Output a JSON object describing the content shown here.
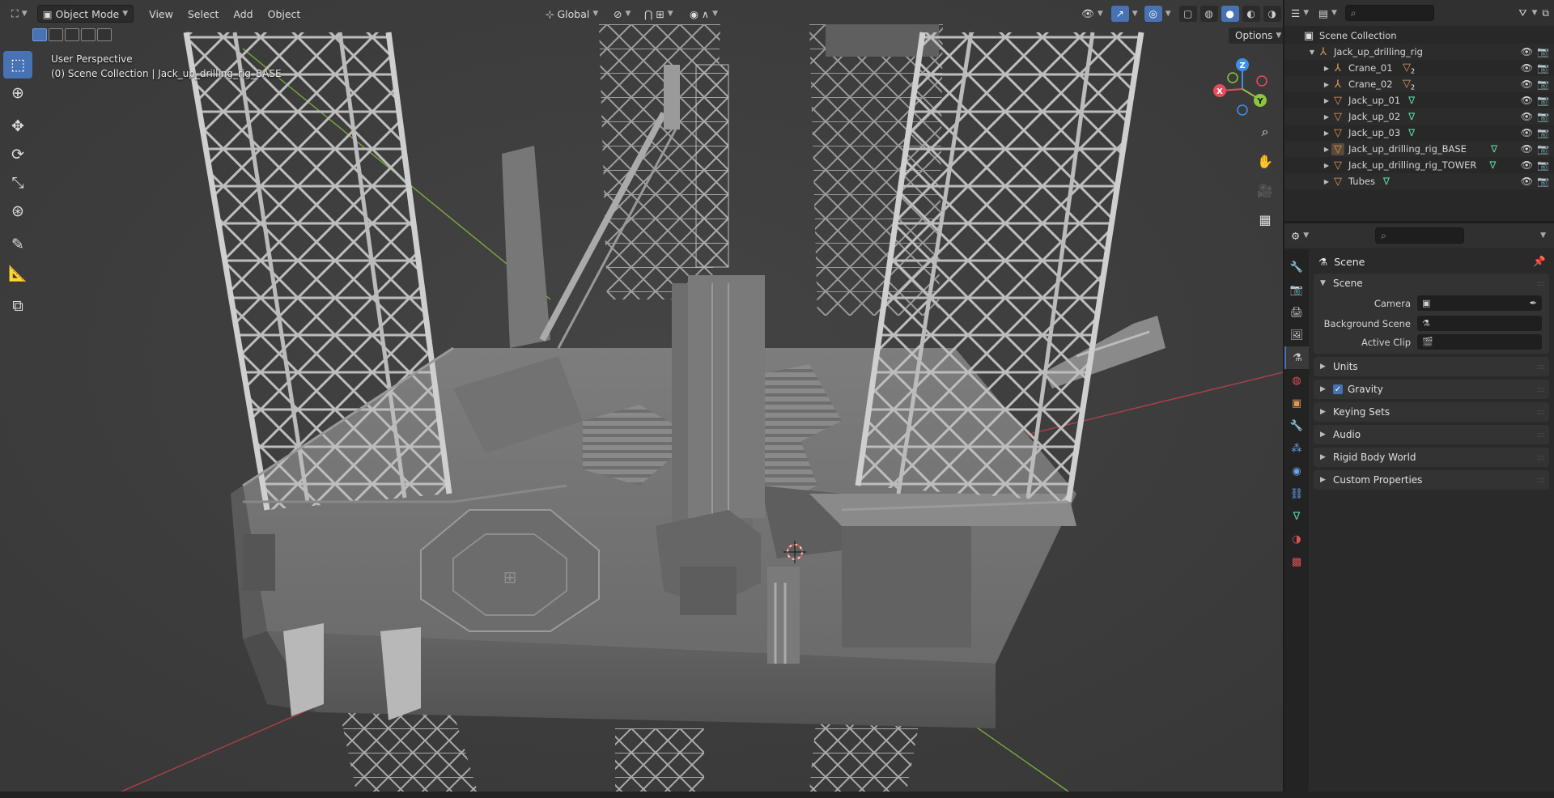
{
  "viewport_header": {
    "mode": "Object Mode",
    "menus": [
      "View",
      "Select",
      "Add",
      "Object"
    ],
    "transform_orientation": "Global",
    "options_label": "Options"
  },
  "viewport_info": {
    "view_name": "User Perspective",
    "context": "(0) Scene Collection | Jack_up_drilling_rig_BASE"
  },
  "gizmo": {
    "x": "X",
    "y": "Y",
    "z": "Z"
  },
  "toolbar": {
    "tools": [
      "select-box-icon",
      "cursor-icon",
      "move-icon",
      "rotate-icon",
      "scale-icon",
      "transform-icon",
      "annotate-icon",
      "measure-icon",
      "add-cube-icon"
    ],
    "active": "select-box-icon"
  },
  "outliner": {
    "root": "Scene Collection",
    "collection": "Jack_up_drilling_rig",
    "items": [
      {
        "name": "Crane_01",
        "type": "empty",
        "badge": "2"
      },
      {
        "name": "Crane_02",
        "type": "empty",
        "badge": "2"
      },
      {
        "name": "Jack_up_01",
        "type": "mesh"
      },
      {
        "name": "Jack_up_02",
        "type": "mesh"
      },
      {
        "name": "Jack_up_03",
        "type": "mesh"
      },
      {
        "name": "Jack_up_drilling_rig_BASE",
        "type": "mesh"
      },
      {
        "name": "Jack_up_drilling_rig_TOWER",
        "type": "mesh"
      },
      {
        "name": "Tubes",
        "type": "mesh"
      }
    ]
  },
  "properties": {
    "context_title": "Scene",
    "scene_panel": {
      "title": "Scene",
      "camera_label": "Camera",
      "background_label": "Background Scene",
      "clip_label": "Active Clip"
    },
    "panels": [
      "Units",
      "Gravity",
      "Keying Sets",
      "Audio",
      "Rigid Body World",
      "Custom Properties"
    ],
    "gravity_checked": true
  },
  "colors": {
    "accent": "#4772b3",
    "viewport_bg": "#3d3d3d",
    "axis_x": "#e84a5f",
    "axis_y": "#8cc63f",
    "axis_z": "#3f8fe8"
  }
}
